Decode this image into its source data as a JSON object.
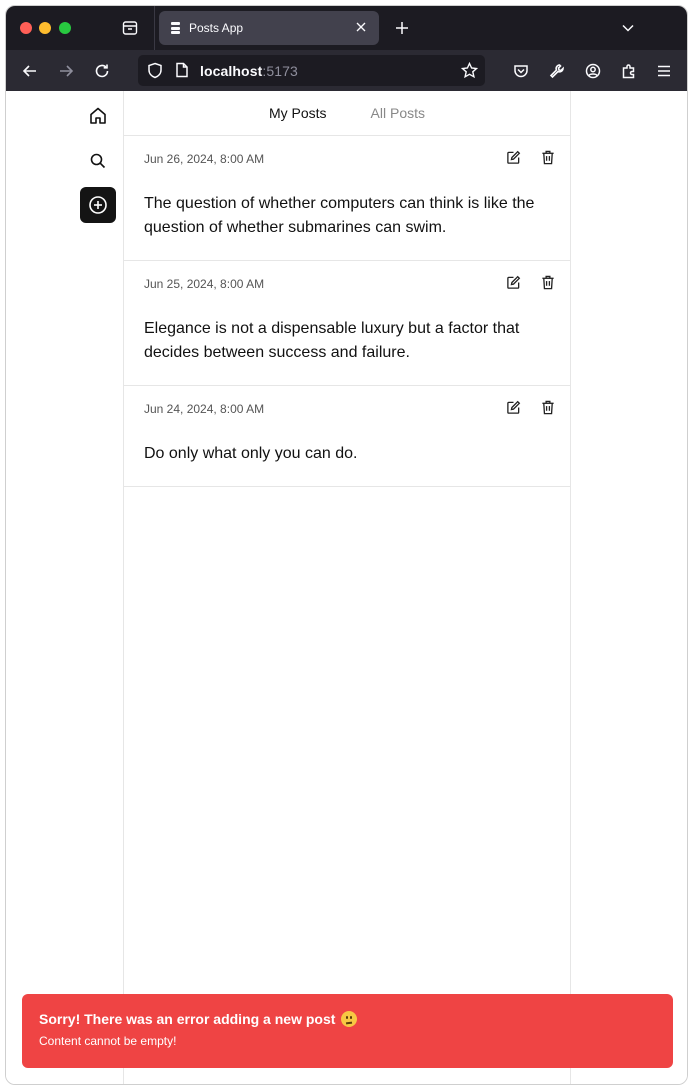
{
  "browser": {
    "tab": {
      "title": "Posts App"
    },
    "url": {
      "host": "localhost",
      "port": ":5173"
    }
  },
  "feed": {
    "tabs": [
      {
        "label": "My Posts",
        "active": true
      },
      {
        "label": "All Posts",
        "active": false
      }
    ],
    "posts": [
      {
        "date": "Jun 26, 2024, 8:00 AM",
        "content": "The question of whether computers can think is like the question of whether submarines can swim."
      },
      {
        "date": "Jun 25, 2024, 8:00 AM",
        "content": "Elegance is not a dispensable luxury but a factor that decides between success and failure."
      },
      {
        "date": "Jun 24, 2024, 8:00 AM",
        "content": "Do only what only you can do."
      }
    ]
  },
  "toast": {
    "title": "Sorry! There was an error adding a new post",
    "description": "Content cannot be empty!",
    "color": "#ef4444"
  }
}
